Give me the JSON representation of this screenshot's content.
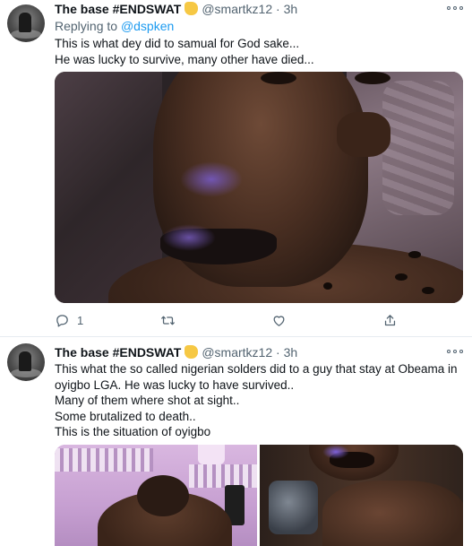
{
  "tweets": [
    {
      "display_name": "The base #ENDSWAT",
      "handle": "@smartkz12",
      "separator": "·",
      "time": "3h",
      "replying_label": "Replying to",
      "replying_to": "@dspken",
      "lines": [
        "This is what dey did to samual for God sake...",
        "He was lucky to survive, many other have died..."
      ],
      "reply_count": "1",
      "icons": [
        "reply-icon",
        "retweet-icon",
        "like-icon",
        "share-icon"
      ]
    },
    {
      "display_name": "The base #ENDSWAT",
      "handle": "@smartkz12",
      "separator": "·",
      "time": "3h",
      "lines": [
        "This what the so called nigerian solders did to a guy that stay at Obeama in",
        "oyigbo LGA. He was lucky to have survived..",
        "Many of them where shot at sight..",
        "Some brutalized to death..",
        "This is the situation of oyigbo"
      ]
    }
  ],
  "colors": {
    "text": "#0f1419",
    "secondary": "#536471",
    "link": "#1d9bf0",
    "divider": "#e6ecf0",
    "emoji": "#f6c844"
  }
}
